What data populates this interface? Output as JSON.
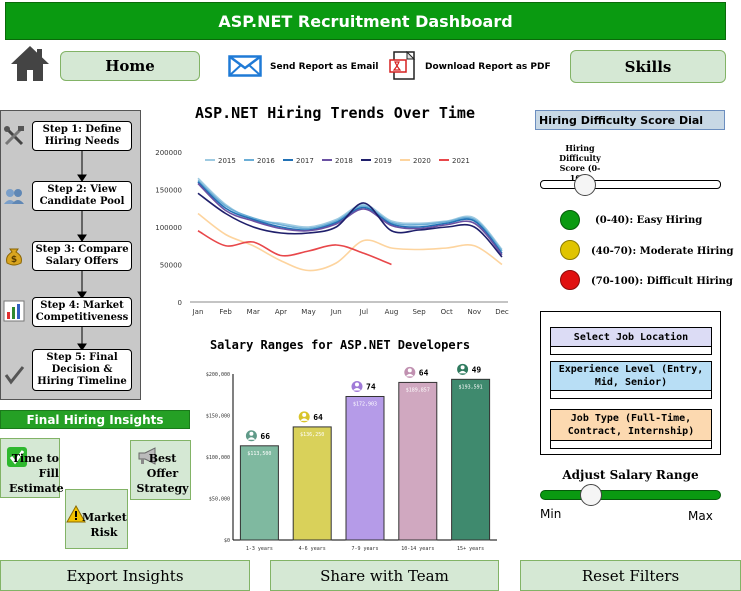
{
  "header": {
    "title": "ASP.NET Recruitment Dashboard"
  },
  "nav": {
    "home_label": "Home",
    "skills_label": "Skills",
    "email_label": "Send Report as Email",
    "pdf_label": "Download Report as PDF"
  },
  "workflow": {
    "steps": [
      {
        "label": "Step 1: Define Hiring Needs",
        "icon": "tools-icon"
      },
      {
        "label": "Step 2: View Candidate Pool",
        "icon": "users-icon"
      },
      {
        "label": "Step 3: Compare Salary Offers",
        "icon": "money-bag-icon"
      },
      {
        "label": "Step 4: Market Competitiveness",
        "icon": "bar-chart-icon"
      },
      {
        "label": "Step 5: Final Decision & Hiring Timeline",
        "icon": "checkmark-icon"
      }
    ]
  },
  "insights": {
    "title": "Final Hiring Insights",
    "time_to_fill": "Time to Fill Estimate",
    "market_risk": "Market Risk",
    "best_offer": "Best Offer Strategy"
  },
  "trend_chart": {
    "title": "ASP.NET Hiring Trends Over Time",
    "y_ticks": [
      "200000",
      "150000",
      "100000",
      "50000",
      "0"
    ],
    "months": [
      "Jan",
      "Feb",
      "Mar",
      "Apr",
      "May",
      "Jun",
      "Jul",
      "Aug",
      "Sep",
      "Oct",
      "Nov",
      "Dec"
    ]
  },
  "salary_chart": {
    "title": "Salary Ranges for ASP.NET Developers",
    "y_ticks": [
      "$200,000",
      "$150,000",
      "$100,000",
      "$50,000",
      "$0"
    ]
  },
  "chart_data": [
    {
      "type": "line",
      "title": "ASP.NET Hiring Trends Over Time",
      "x": [
        "Jan",
        "Feb",
        "Mar",
        "Apr",
        "May",
        "Jun",
        "Jul",
        "Aug",
        "Sep",
        "Oct",
        "Nov",
        "Dec"
      ],
      "ylim": [
        0,
        200000
      ],
      "grid": false,
      "legend": "top",
      "series": [
        {
          "name": "2015",
          "color": "#9ecae1",
          "values": [
            165000,
            130000,
            110000,
            105000,
            100000,
            110000,
            130000,
            108000,
            105000,
            108000,
            112000,
            70000
          ]
        },
        {
          "name": "2016",
          "color": "#6baed6",
          "values": [
            162000,
            128000,
            112000,
            103000,
            98000,
            108000,
            128000,
            106000,
            103000,
            107000,
            110000,
            68000
          ]
        },
        {
          "name": "2017",
          "color": "#2171b5",
          "values": [
            160000,
            125000,
            110000,
            100000,
            96000,
            106000,
            126000,
            104000,
            100000,
            105000,
            108000,
            65000
          ]
        },
        {
          "name": "2018",
          "color": "#6a51a3",
          "values": [
            158000,
            122000,
            108000,
            98000,
            95000,
            104000,
            124000,
            102000,
            98000,
            103000,
            105000,
            63000
          ]
        },
        {
          "name": "2019",
          "color": "#1f1f6b",
          "values": [
            145000,
            118000,
            100000,
            92000,
            92000,
            100000,
            132000,
            95000,
            96000,
            100000,
            100000,
            60000
          ]
        },
        {
          "name": "2020",
          "color": "#fdd49e",
          "values": [
            118000,
            90000,
            75000,
            55000,
            42000,
            52000,
            82000,
            72000,
            70000,
            72000,
            75000,
            50000
          ]
        },
        {
          "name": "2021",
          "color": "#e8474a",
          "values": [
            95000,
            75000,
            80000,
            62000,
            68000,
            76000,
            65000,
            50000
          ]
        }
      ]
    },
    {
      "type": "bar",
      "title": "Salary Ranges for ASP.NET Developers",
      "categories": [
        "1-3 years",
        "4-6 years",
        "7-9 years",
        "10-14 years",
        "15+ years"
      ],
      "ylim": [
        0,
        200000
      ],
      "values": [
        113500,
        136250,
        172903,
        189857,
        193591
      ],
      "value_labels": [
        "$113,500",
        "$136,250",
        "$172,903",
        "$189,857",
        "$193,591"
      ],
      "counts": [
        66,
        64,
        74,
        64,
        49
      ],
      "colors": [
        "#7fb9a0",
        "#d9d15a",
        "#b59be8",
        "#d0a8c0",
        "#3f8a6e"
      ],
      "badge_colors": [
        "#5f9a88",
        "#d9c42a",
        "#a07ad8",
        "#c090b0",
        "#2f7a5e"
      ]
    }
  ],
  "dial": {
    "title": "Hiring Difficulty Score Dial",
    "label": "Hiring Difficulty Score (0-100)",
    "score": 25,
    "levels": [
      {
        "label": "(0-40): Easy Hiring",
        "color": "#0a9a11"
      },
      {
        "label": "(40-70): Moderate Hiring",
        "color": "#e0c400"
      },
      {
        "label": "(70-100): Difficult Hiring",
        "color": "#e01010"
      }
    ]
  },
  "filters": {
    "location": "Select Job Location",
    "experience": "Experience Level (Entry, Mid, Senior)",
    "job_type": "Job Type (Full-Time, Contract, Internship)"
  },
  "salary_slider": {
    "title": "Adjust Salary Range",
    "min_label": "Min",
    "max_label": "Max",
    "value": 0.28
  },
  "footer": {
    "export_label": "Export Insights",
    "share_label": "Share with Team",
    "reset_label": "Reset Filters"
  }
}
